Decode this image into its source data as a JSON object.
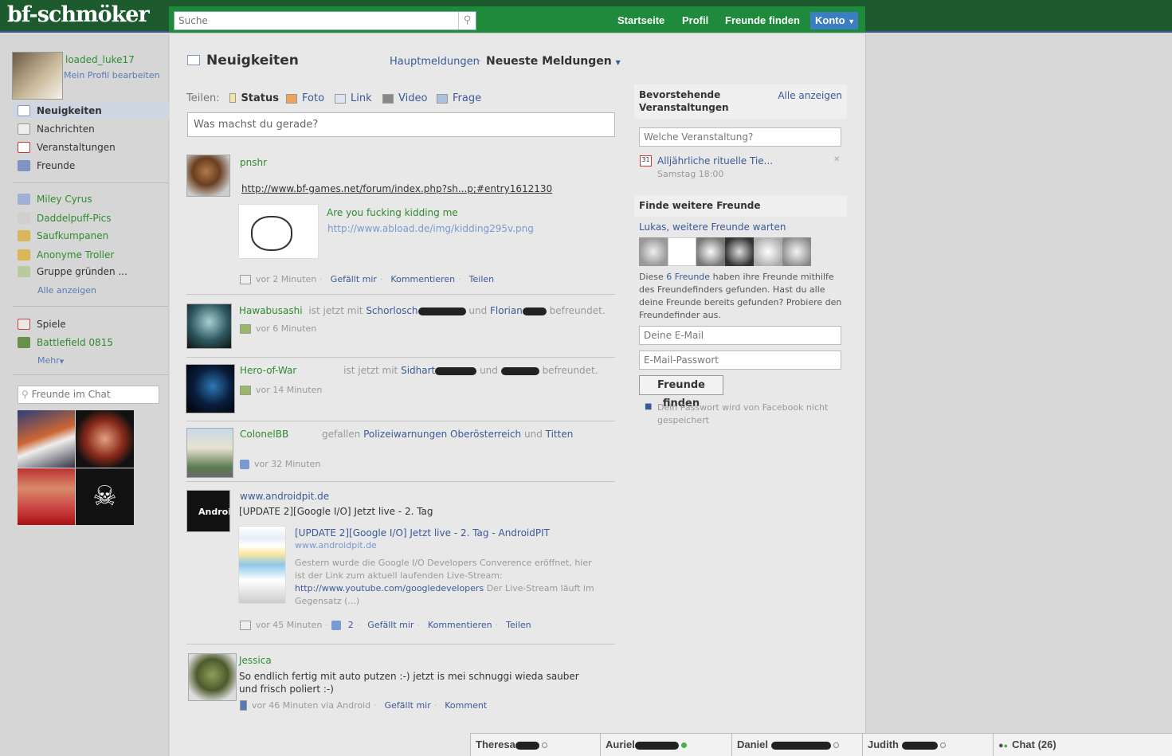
{
  "app": {
    "logo": "bf-schmöker"
  },
  "topnav": {
    "search_placeholder": "Suche",
    "links": [
      "Startseite",
      "Profil",
      "Freunde finden"
    ],
    "konto": "Konto"
  },
  "profile": {
    "name": "loaded_luke17",
    "edit": "Mein Profil bearbeiten"
  },
  "leftnav": {
    "main": [
      "Neuigkeiten",
      "Nachrichten",
      "Veranstaltungen",
      "Freunde"
    ],
    "groups": [
      "Miley Cyrus",
      "Daddelpuff-Pics",
      "Saufkumpanen",
      "Anonyme Troller",
      "Gruppe gründen ..."
    ],
    "show_all": "Alle anzeigen",
    "apps": [
      "Spiele",
      "Battlefield 0815"
    ],
    "more": "Mehr",
    "chat_search": "Freunde im Chat"
  },
  "feed": {
    "title": "Neuigkeiten",
    "filter_top": "Hauptmeldungen",
    "filter_recent": "Neueste Meldungen",
    "share_label": "Teilen:",
    "share_options": [
      "Status",
      "Foto",
      "Link",
      "Video",
      "Frage"
    ],
    "status_placeholder": "Was machst du gerade?",
    "posts": [
      {
        "author": "pnshr",
        "link": "http://www.bf-games.net/forum/index.php?sh...p;#entry1612130",
        "attach_title": "Are you fucking kidding me",
        "attach_url": "http://www.abload.de/img/kidding295v.png",
        "time": "vor 2 Minuten",
        "actions": [
          "Gefällt mir",
          "Kommentieren",
          "Teilen"
        ]
      },
      {
        "author": "Hawabusashi",
        "text_pre": "ist jetzt mit",
        "friend1": "Schorlosch",
        "and": "und",
        "friend2": "Florian",
        "text_post": "befreundet.",
        "time": "vor 6 Minuten"
      },
      {
        "author": "Hero-of-War",
        "text_pre": "ist jetzt mit",
        "friend1": "Sidhart",
        "and": "und",
        "text_post": "befreundet.",
        "time": "vor 14 Minuten"
      },
      {
        "author": "ColonelBB",
        "text_pre": "gefallen",
        "page1": "Polizeiwarnungen Oberösterreich",
        "and": "und",
        "page2": "Titten",
        "time": "vor 32 Minuten"
      },
      {
        "author": "www.androidpit.de",
        "text": "[UPDATE 2][Google I/O] Jetzt live - 2. Tag",
        "avatar_text": "Androi",
        "attach_title": "[UPDATE 2][Google I/O] Jetzt live - 2. Tag - AndroidPIT",
        "attach_domain": "www.androidpit.de",
        "attach_desc1": "Gestern wurde die Google I/O Developers Converence eröffnet, hier ist der Link zum aktuell laufenden Live-Stream:",
        "attach_link": "http://www.youtube.com/googledevelopers",
        "attach_desc2": "Der Live-Stream läuft im Gegensatz (...)",
        "time": "vor 45 Minuten",
        "likes": "2",
        "actions": [
          "Gefällt mir",
          "Kommentieren",
          "Teilen"
        ]
      },
      {
        "author": "Jessica",
        "text": "So endlich fertig mit auto putzen :-) jetzt is mei schnuggi wieda sauber und frisch poliert :-)",
        "time": "vor 46 Minuten via Android",
        "actions": [
          "Gefällt mir",
          "Komment"
        ]
      }
    ]
  },
  "events": {
    "title": "Bevorstehende Veranstaltungen",
    "show_all": "Alle anzeigen",
    "input_placeholder": "Welche Veranstaltung?",
    "item_title": "Alljährliche rituelle Tie...",
    "item_date": "Samstag 18:00"
  },
  "friends_finder": {
    "title": "Finde weitere Freunde",
    "subtitle": "Lukas, weitere Freunde warten",
    "desc_pre": "Diese",
    "desc_link": "6 Freunde",
    "desc_post": "haben ihre Freunde mithilfe des Freundefinders gefunden. Hast du alle deine Freunde bereits gefunden? Probiere den Freundefinder aus.",
    "email_placeholder": "Deine E-Mail",
    "password_placeholder": "E-Mail-Passwort",
    "button": "Freunde finden",
    "note": "Dein Passwort wird von Facebook nicht gespeichert"
  },
  "chatbar": {
    "tabs": [
      "Theresa",
      "Auriel",
      "Daniel",
      "Judith"
    ],
    "chat_label": "Chat (26)"
  }
}
